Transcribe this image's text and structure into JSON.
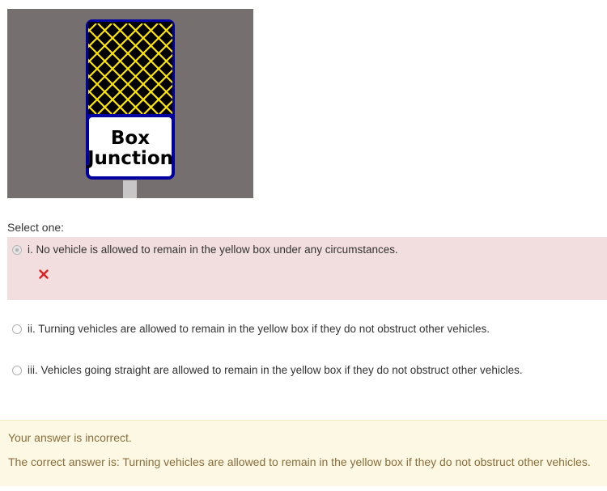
{
  "question": {
    "sign": {
      "text_line1": "Box",
      "text_line2": "Junction",
      "colors": {
        "background": "#766f6f",
        "border": "#0000a0",
        "grid_lines": "#ffe600",
        "grid_background": "#000000",
        "panel": "#ffffff",
        "post": "#c8c6c6"
      }
    },
    "prompt": "Select one:",
    "answers": [
      {
        "label": "i. No vehicle is allowed to remain in the yellow box under any circumstances.",
        "selected": true,
        "state": "incorrect",
        "mark_icon": "cross-icon"
      },
      {
        "label": "ii. Turning vehicles are allowed to remain in the yellow box if they do not obstruct other vehicles.",
        "selected": false
      },
      {
        "label": "iii. Vehicles going straight are allowed to remain in the yellow box if they do not obstruct other vehicles.",
        "selected": false
      }
    ]
  },
  "feedback": {
    "status": "Your answer is incorrect.",
    "correct_answer": "The correct answer is: Turning vehicles are allowed to remain in the yellow box if they do not obstruct other vehicles."
  },
  "colors": {
    "incorrect_bg": "#f2dede",
    "feedback_bg": "#fcf8e3",
    "feedback_text": "#8a6d3b",
    "cross": "#e02020"
  }
}
